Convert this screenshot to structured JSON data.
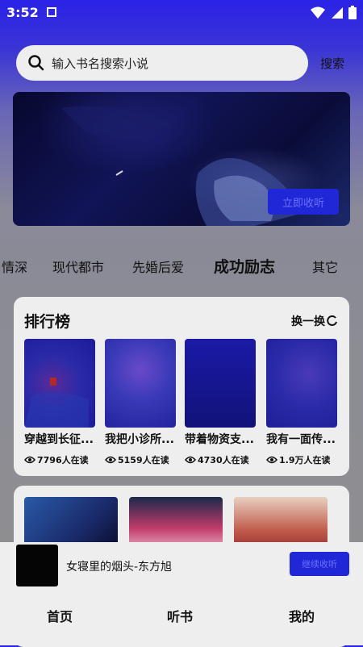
{
  "status_bar": {
    "time": "3:52"
  },
  "search": {
    "placeholder": "输入书名搜索小说",
    "button_label": "搜索"
  },
  "banner": {
    "button_label": "立即收听"
  },
  "categories": [
    "情深",
    "现代都市",
    "先婚后爱",
    "成功励志",
    "其它"
  ],
  "active_category": "成功励志",
  "ranking": {
    "title": "排行榜",
    "refresh_label": "换一换",
    "books": [
      {
        "title": "穿越到长征...",
        "reads": "7796人在读"
      },
      {
        "title": "我把小诊所...",
        "reads": "5159人在读"
      },
      {
        "title": "带着物资支...",
        "reads": "4730人在读"
      },
      {
        "title": "我有一面传...",
        "reads": "1.9万人在读"
      }
    ]
  },
  "player": {
    "title": "女寝里的烟头-东方旭",
    "button_label": "继续收听"
  },
  "bottom_nav": {
    "home": "首页",
    "listen": "听书",
    "mine": "我的"
  }
}
